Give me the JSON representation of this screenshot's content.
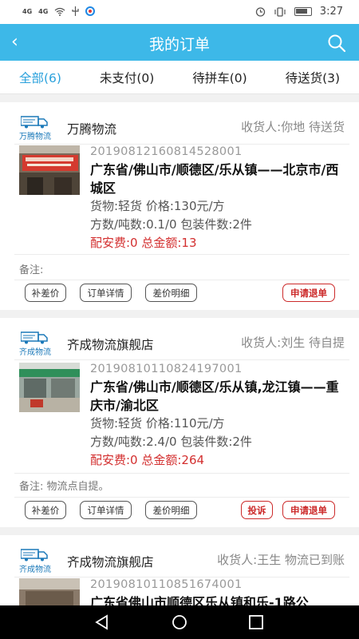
{
  "status": {
    "time": "3:27",
    "net1": "4G",
    "net2": "4G"
  },
  "header": {
    "title": "我的订单",
    "back_icon": "‹"
  },
  "tabs": [
    {
      "label": "全部(6)",
      "active": true
    },
    {
      "label": "未支付(0)"
    },
    {
      "label": "待拼车(0)"
    },
    {
      "label": "待送货(3)"
    }
  ],
  "orders": [
    {
      "logo_text": "万腾物流",
      "shop": "万腾物流",
      "receiver_status": "收货人:你地 待送货",
      "code": "20190812160814528001",
      "address": "广东省/佛山市/顺德区/乐从镇——北京市/西城区",
      "cargo": "货物:轻货 价格:130元/方",
      "volume": "方数/吨数:0.1/0 包装件数:2件",
      "fee": "配安费:0 总金额:13",
      "remark": "备注:",
      "buttons": [
        "补差价",
        "订单详情",
        "差价明细"
      ],
      "red_buttons": [
        "申请退单"
      ]
    },
    {
      "logo_text": "齐成物流",
      "shop": "齐成物流旗舰店",
      "receiver_status": "收货人:刘生 待自提",
      "code": "20190810110824197001",
      "address": "广东省/佛山市/顺德区/乐从镇,龙江镇——重庆市/渝北区",
      "cargo": "货物:轻货 价格:110元/方",
      "volume": "方数/吨数:2.4/0 包装件数:2件",
      "fee": "配安费:0 总金额:264",
      "remark": "备注:   物流点自提。",
      "buttons": [
        "补差价",
        "订单详情",
        "差价明细"
      ],
      "red_buttons": [
        "投诉",
        "申请退单"
      ]
    },
    {
      "logo_text": "齐成物流",
      "shop": "齐成物流旗舰店",
      "receiver_status": "收货人:王生 物流已到账",
      "code": "20190810110851674001",
      "address": "广东省佛山市顺德区乐从镇和乐-1路公"
    }
  ],
  "colors": {
    "accent": "#3db8e8",
    "tab_active": "#2aa1dc",
    "fee_red": "#d32f2f"
  }
}
